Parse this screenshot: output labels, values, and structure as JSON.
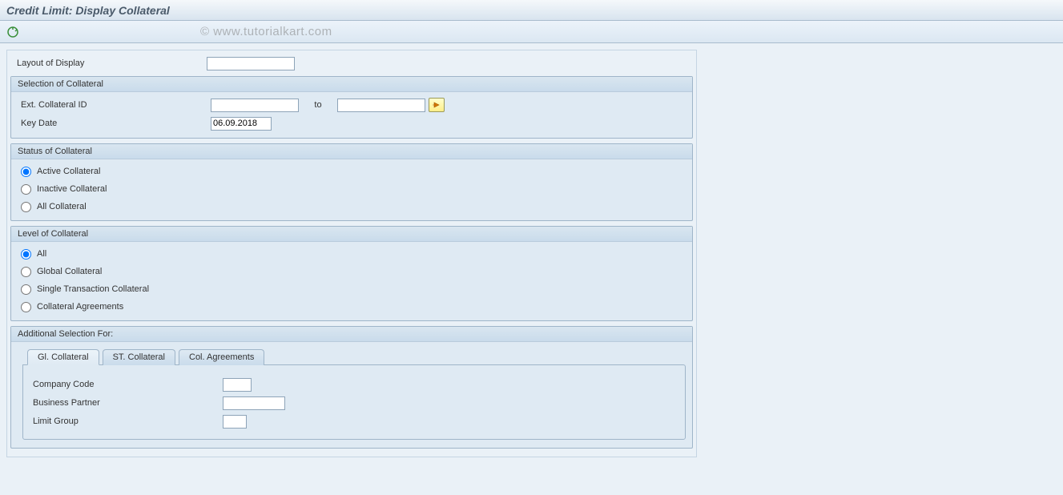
{
  "header": {
    "title": "Credit Limit: Display Collateral"
  },
  "watermark": "© www.tutorialkart.com",
  "layout_row": {
    "label": "Layout of Display",
    "value": ""
  },
  "selection_group": {
    "title": "Selection of Collateral",
    "ext_id_label": "Ext. Collateral ID",
    "ext_id_from": "",
    "to_label": "to",
    "ext_id_to": "",
    "key_date_label": "Key Date",
    "key_date_value": "06.09.2018"
  },
  "status_group": {
    "title": "Status of Collateral",
    "options": [
      "Active Collateral",
      "Inactive Collateral",
      "All Collateral"
    ],
    "selected": 0
  },
  "level_group": {
    "title": "Level of Collateral",
    "options": [
      "All",
      "Global Collateral",
      "Single Transaction Collateral",
      "Collateral Agreements"
    ],
    "selected": 0
  },
  "additional_group": {
    "title": "Additional Selection For:",
    "tabs": [
      "Gl. Collateral",
      "ST. Collateral",
      "Col. Agreements"
    ],
    "active_tab": 0,
    "fields": {
      "company_code": {
        "label": "Company Code",
        "value": ""
      },
      "business_partner": {
        "label": "Business Partner",
        "value": ""
      },
      "limit_group": {
        "label": "Limit Group",
        "value": ""
      }
    }
  }
}
